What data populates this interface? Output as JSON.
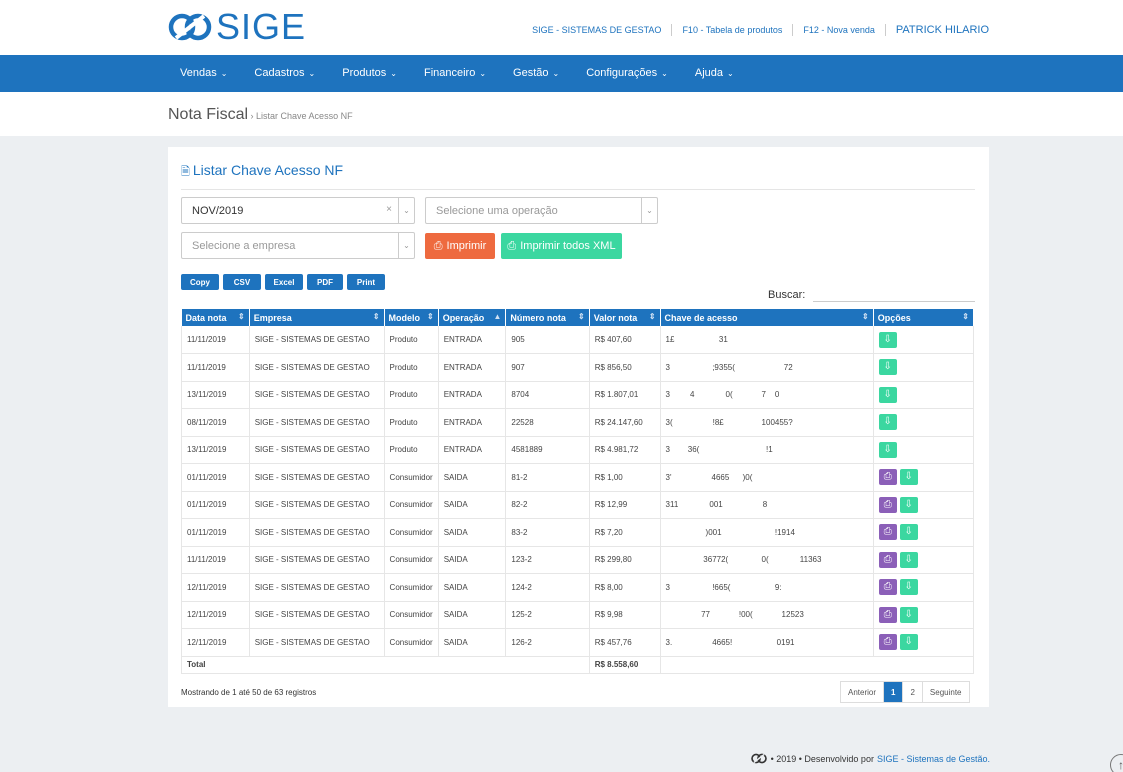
{
  "brand": {
    "name": "SIGE",
    "accent": "#1e73be"
  },
  "toplinks": {
    "company": "SIGE - SISTEMAS DE GESTAO",
    "f10": "F10 - Tabela de produtos",
    "f12": "F12 - Nova venda",
    "user": "PATRICK HILARIO"
  },
  "nav": [
    "Vendas",
    "Cadastros",
    "Produtos",
    "Financeiro",
    "Gestão",
    "Configurações",
    "Ajuda"
  ],
  "breadcrumb": {
    "title": "Nota Fiscal",
    "sep": " › ",
    "page": "Listar Chave Acesso NF"
  },
  "panel": {
    "title": "Listar Chave Acesso NF",
    "period_value": "NOV/2019",
    "operation_placeholder": "Selecione uma operação",
    "company_placeholder": "Selecione a empresa",
    "print_label": "Imprimir",
    "print_all_label": "Imprimir todos XML"
  },
  "export_buttons": [
    "Copy",
    "CSV",
    "Excel",
    "PDF",
    "Print"
  ],
  "search_label": "Buscar:",
  "columns": [
    "Data nota",
    "Empresa",
    "Modelo",
    "Operação",
    "Número nota",
    "Valor nota",
    "Chave de acesso",
    "Opções"
  ],
  "rows": [
    {
      "data": "11/11/2019",
      "empresa": "SIGE - SISTEMAS DE GESTAO",
      "modelo": "Produto",
      "operacao": "ENTRADA",
      "numero": "905",
      "valor": "R$ 407,60",
      "chave": "1£                    31",
      "pdf": false
    },
    {
      "data": "11/11/2019",
      "empresa": "SIGE - SISTEMAS DE GESTAO",
      "modelo": "Produto",
      "operacao": "ENTRADA",
      "numero": "907",
      "valor": "R$ 856,50",
      "chave": "3                   ;9355(                      72",
      "pdf": false
    },
    {
      "data": "13/11/2019",
      "empresa": "SIGE - SISTEMAS DE GESTAO",
      "modelo": "Produto",
      "operacao": "ENTRADA",
      "numero": "8704",
      "valor": "R$ 1.807,01",
      "chave": "3         4              0(             7    0",
      "pdf": false
    },
    {
      "data": "08/11/2019",
      "empresa": "SIGE - SISTEMAS DE GESTAO",
      "modelo": "Produto",
      "operacao": "ENTRADA",
      "numero": "22528",
      "valor": "R$ 24.147,60",
      "chave": "3(                  !8£                 100455?",
      "pdf": false
    },
    {
      "data": "13/11/2019",
      "empresa": "SIGE - SISTEMAS DE GESTAO",
      "modelo": "Produto",
      "operacao": "ENTRADA",
      "numero": "4581889",
      "valor": "R$ 4.981,72",
      "chave": "3        36(                              !1",
      "pdf": false
    },
    {
      "data": "01/11/2019",
      "empresa": "SIGE - SISTEMAS DE GESTAO",
      "modelo": "Consumidor",
      "operacao": "SAIDA",
      "numero": "81-2",
      "valor": "R$ 1,00",
      "chave": "3'                  4665      )0(",
      "pdf": true
    },
    {
      "data": "01/11/2019",
      "empresa": "SIGE - SISTEMAS DE GESTAO",
      "modelo": "Consumidor",
      "operacao": "SAIDA",
      "numero": "82-2",
      "valor": "R$ 12,99",
      "chave": "311              001                  8",
      "pdf": true
    },
    {
      "data": "01/11/2019",
      "empresa": "SIGE - SISTEMAS DE GESTAO",
      "modelo": "Consumidor",
      "operacao": "SAIDA",
      "numero": "83-2",
      "valor": "R$ 7,20",
      "chave": "                  )001                        !1914",
      "pdf": true
    },
    {
      "data": "11/11/2019",
      "empresa": "SIGE - SISTEMAS DE GESTAO",
      "modelo": "Consumidor",
      "operacao": "SAIDA",
      "numero": "123-2",
      "valor": "R$ 299,80",
      "chave": "                 36772(               0(              11363",
      "pdf": true
    },
    {
      "data": "12/11/2019",
      "empresa": "SIGE - SISTEMAS DE GESTAO",
      "modelo": "Consumidor",
      "operacao": "SAIDA",
      "numero": "124-2",
      "valor": "R$ 8,00",
      "chave": "3                   !665(                    9:",
      "pdf": true
    },
    {
      "data": "12/11/2019",
      "empresa": "SIGE - SISTEMAS DE GESTAO",
      "modelo": "Consumidor",
      "operacao": "SAIDA",
      "numero": "125-2",
      "valor": "R$ 9,98",
      "chave": "                77             !00(             12523",
      "pdf": true
    },
    {
      "data": "12/11/2019",
      "empresa": "SIGE - SISTEMAS DE GESTAO",
      "modelo": "Consumidor",
      "operacao": "SAIDA",
      "numero": "126-2",
      "valor": "R$ 457,76",
      "chave": "3.                  4665!                    0191",
      "pdf": true
    }
  ],
  "total": {
    "label": "Total",
    "value": "R$ 8.558,60"
  },
  "showing": "Mostrando de 1 até 50 de 63 registros",
  "pager": {
    "prev": "Anterior",
    "pages": [
      "1",
      "2"
    ],
    "next": "Seguinte"
  },
  "footer": {
    "text": "• 2019 • Desenvolvido por",
    "brand": "SIGE - Sistemas de Gestão."
  }
}
